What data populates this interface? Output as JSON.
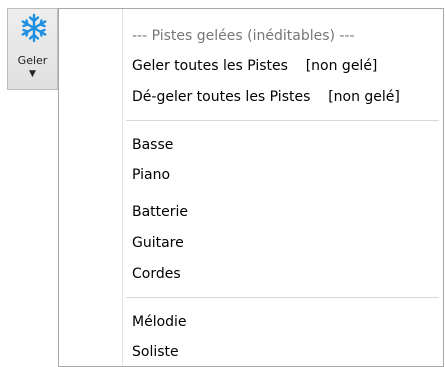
{
  "toolbar": {
    "freeze_button": {
      "label": "Geler",
      "arrow": "▼",
      "icon": "snowflake-icon",
      "icon_color": "#1e8fe0"
    }
  },
  "menu": {
    "header": "--- Pistes gelées (inéditables) ---",
    "freeze_all": "Geler toutes les Pistes    [non gelé]",
    "unfreeze_all": "Dé-geler toutes les Pistes    [non gelé]",
    "tracks": [
      "Basse",
      "Piano",
      "Batterie",
      "Guitare",
      "Cordes"
    ],
    "tracks2": [
      "Mélodie",
      "Soliste"
    ]
  }
}
